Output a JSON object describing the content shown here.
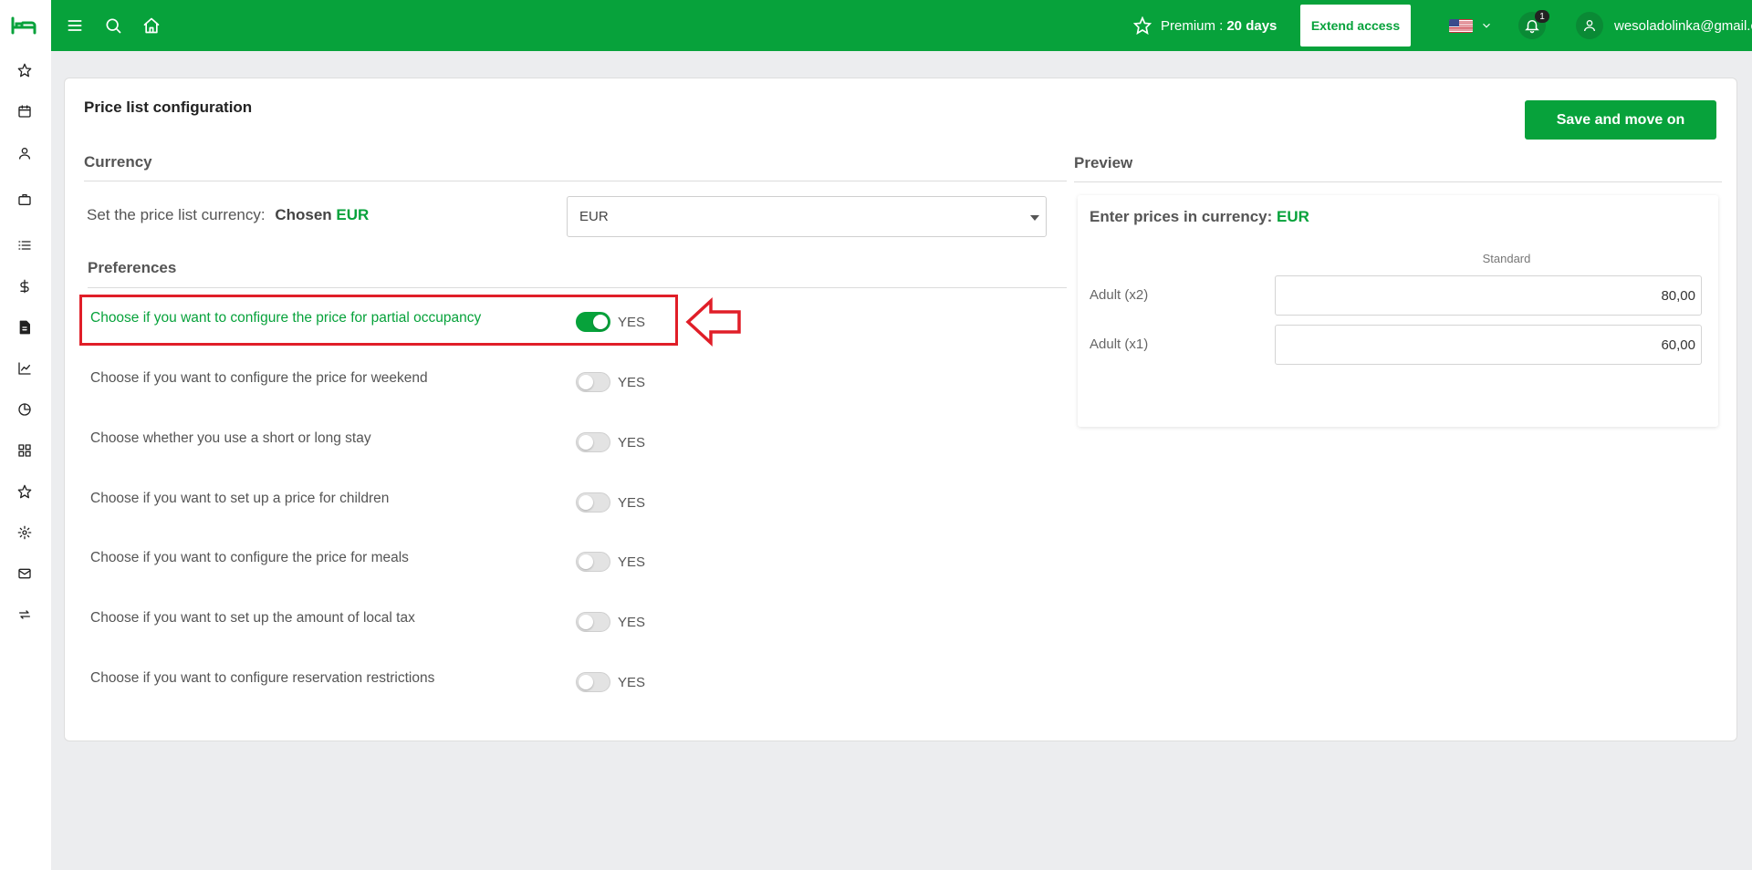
{
  "sidebar": {
    "items": [
      {
        "name": "sidebar-item-favorites",
        "icon": "star-icon"
      },
      {
        "name": "sidebar-item-calendar",
        "icon": "calendar-icon"
      },
      {
        "name": "sidebar-item-guests",
        "icon": "user-icon"
      },
      {
        "name": "sidebar-item-briefcase",
        "icon": "briefcase-icon"
      },
      {
        "name": "sidebar-item-list",
        "icon": "list-icon"
      },
      {
        "name": "sidebar-item-pricing",
        "icon": "dollar-icon"
      },
      {
        "name": "sidebar-item-invoices",
        "icon": "file-icon"
      },
      {
        "name": "sidebar-item-reports",
        "icon": "chart-icon"
      },
      {
        "name": "sidebar-item-statistics",
        "icon": "pie-icon"
      },
      {
        "name": "sidebar-item-apps",
        "icon": "grid-icon"
      },
      {
        "name": "sidebar-item-reviews",
        "icon": "star-icon"
      },
      {
        "name": "sidebar-item-settings",
        "icon": "gear-icon"
      },
      {
        "name": "sidebar-item-messages",
        "icon": "mail-icon"
      },
      {
        "name": "sidebar-item-sync",
        "icon": "sync-icon"
      }
    ]
  },
  "topbar": {
    "premium_label": "Premium :",
    "premium_days": "20 days",
    "extend_label": "Extend access",
    "language_flag": "us-flag",
    "notification_count": "1",
    "user_email": "wesoladolinka@gmail.com"
  },
  "main": {
    "title": "Price list configuration",
    "save_button": "Save and move on",
    "currency": {
      "heading": "Currency",
      "label": "Set the price list currency:",
      "chosen_label": "Chosen",
      "chosen_code": "EUR",
      "select_value": "EUR"
    },
    "preferences": {
      "heading": "Preferences",
      "items": [
        {
          "label": "Choose if you want to configure the price for partial occupancy",
          "state": "YES",
          "on": true
        },
        {
          "label": "Choose if you want to configure the price for weekend",
          "state": "YES",
          "on": false
        },
        {
          "label": "Choose whether you use a short or long stay",
          "state": "YES",
          "on": false
        },
        {
          "label": "Choose if you want to set up a price for children",
          "state": "YES",
          "on": false
        },
        {
          "label": "Choose if you want to configure the price for meals",
          "state": "YES",
          "on": false
        },
        {
          "label": "Choose if you want to set up the amount of local tax",
          "state": "YES",
          "on": false
        },
        {
          "label": "Choose if you want to configure reservation restrictions",
          "state": "YES",
          "on": false
        }
      ]
    },
    "preview": {
      "heading": "Preview",
      "title": "Enter prices in currency:",
      "currency": "EUR",
      "column": "Standard",
      "rows": [
        {
          "label": "Adult (x2)",
          "value": "80,00"
        },
        {
          "label": "Adult (x1)",
          "value": "60,00"
        }
      ]
    }
  },
  "colors": {
    "brand_green": "#07a23b",
    "highlight_red": "#e01e28"
  }
}
